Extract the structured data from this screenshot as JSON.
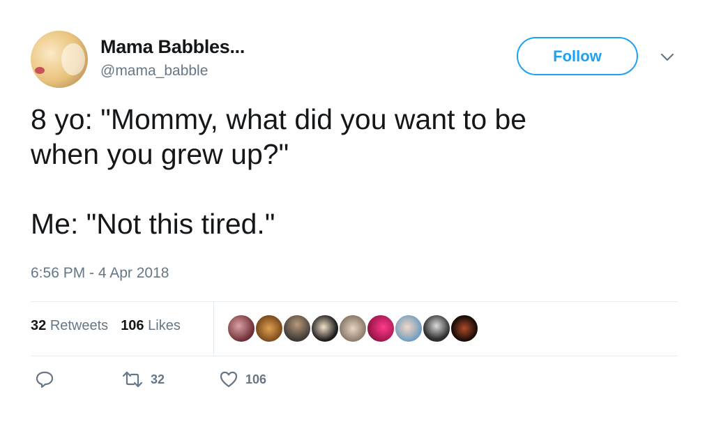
{
  "author": {
    "name": "Mama Babbles...",
    "handle": "@mama_babble"
  },
  "follow_label": "Follow",
  "tweet": {
    "line1": "8 yo: \"Mommy, what did you want to be",
    "line2": "when you grew up?\"",
    "line3": "Me: \"Not this tired.\""
  },
  "timestamp": "6:56 PM - 4 Apr 2018",
  "stats": {
    "retweets_count": "32",
    "retweets_label": "Retweets",
    "likes_count": "106",
    "likes_label": "Likes"
  },
  "actions": {
    "retweet_count": "32",
    "like_count": "106"
  },
  "colors": {
    "accent": "#1da1f2",
    "secondary_text": "#657786",
    "divider": "#e6ecf0"
  },
  "icons": [
    "reply-icon",
    "retweet-icon",
    "heart-icon",
    "chevron-down-icon"
  ]
}
